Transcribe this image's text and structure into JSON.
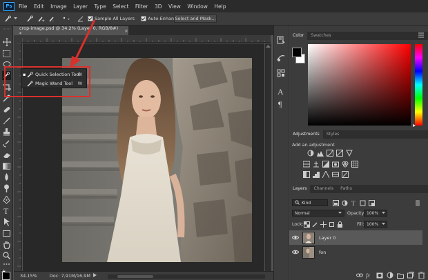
{
  "app": {
    "logo": "Ps"
  },
  "menu": [
    "File",
    "Edit",
    "Image",
    "Layer",
    "Type",
    "Select",
    "Filter",
    "3D",
    "View",
    "Window",
    "Help"
  ],
  "options": {
    "sample_all_layers": "Sample All Layers",
    "auto_enhance": "Auto-Enhance",
    "select_mask": "Select and Mask..."
  },
  "document": {
    "tab_title": "crop-image.psd @ 34.2% (Layer 0, RGB/8#) *",
    "tab_close": "×",
    "zoom": "34.15%",
    "doc_info": "Doc: 7,91M/16,9M"
  },
  "flyout": {
    "items": [
      {
        "label": "Quick Selection Tool",
        "shortcut": "W"
      },
      {
        "label": "Magic Wand Tool",
        "shortcut": "W"
      }
    ]
  },
  "color_panel": {
    "tabs": [
      "Color",
      "Swatches"
    ],
    "foreground": "#000000",
    "background": "#ffffff"
  },
  "adjustments_panel": {
    "tabs": [
      "Adjustments",
      "Styles"
    ],
    "heading": "Add an adjustment"
  },
  "layers_panel": {
    "tabs": [
      "Layers",
      "Channels",
      "Paths"
    ],
    "filter_kind": "Kind",
    "blend_mode": "Normal",
    "opacity_label": "Opacity:",
    "opacity_value": "100%",
    "lock_label": "Lock:",
    "fill_label": "Fill:",
    "fill_value": "100%",
    "layers": [
      {
        "name": "Layer 0",
        "selected": true
      },
      {
        "name": "fon",
        "selected": false
      }
    ]
  },
  "colors": {
    "accent_red": "#d9302c",
    "ps_blue": "#31a8ff"
  }
}
